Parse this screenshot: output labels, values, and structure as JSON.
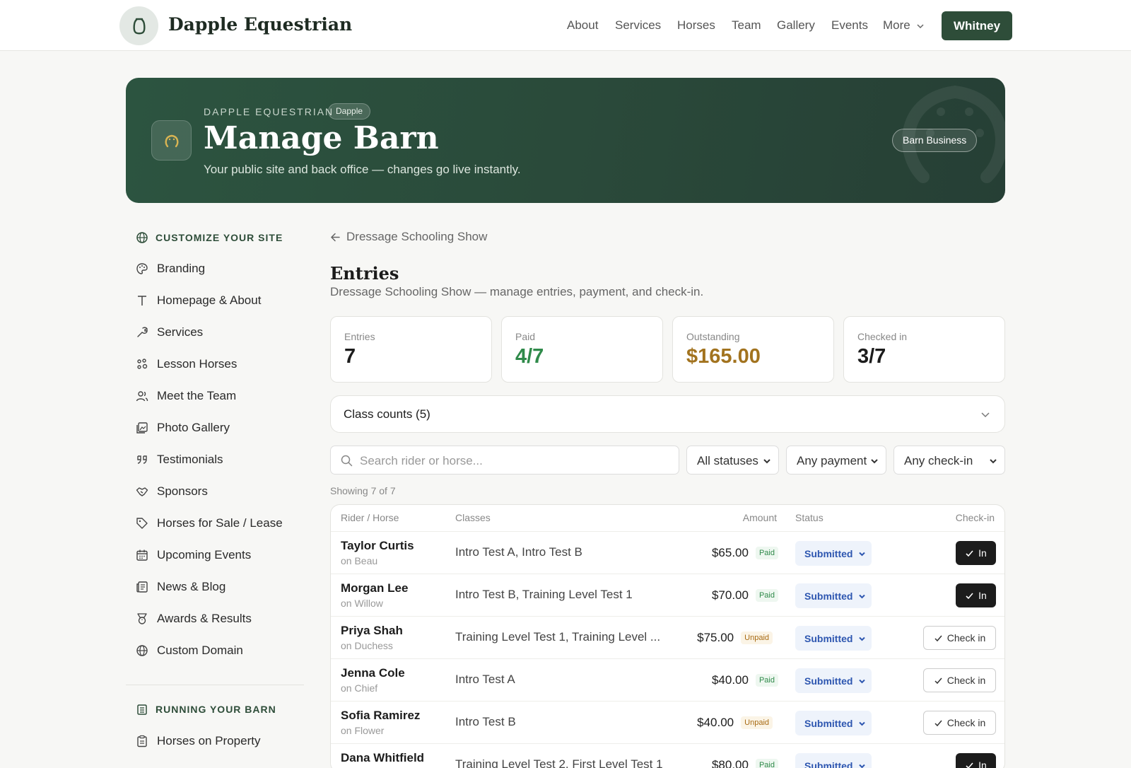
{
  "nav": {
    "brand": "Dapple Equestrian",
    "links": [
      "About",
      "Services",
      "Horses",
      "Team",
      "Gallery",
      "Events",
      "More"
    ],
    "user": "Whitney"
  },
  "hero": {
    "eyebrow": "DAPPLE EQUESTRIAN",
    "chip": "Dapple",
    "title": "Manage Barn",
    "subtitle": "Your public site and back office — changes go live instantly.",
    "badge": "Barn Business"
  },
  "sidebar": {
    "customize_heading": "CUSTOMIZE YOUR SITE",
    "customize_items": [
      {
        "label": "Branding",
        "icon": "palette-icon"
      },
      {
        "label": "Homepage & About",
        "icon": "text-icon"
      },
      {
        "label": "Services",
        "icon": "wrench-icon"
      },
      {
        "label": "Lesson Horses",
        "icon": "horse-icon"
      },
      {
        "label": "Meet the Team",
        "icon": "users-icon"
      },
      {
        "label": "Photo Gallery",
        "icon": "gallery-icon"
      },
      {
        "label": "Testimonials",
        "icon": "quote-icon"
      },
      {
        "label": "Sponsors",
        "icon": "handshake-icon"
      },
      {
        "label": "Horses for Sale / Lease",
        "icon": "tag-icon"
      },
      {
        "label": "Upcoming Events",
        "icon": "calendar-icon"
      },
      {
        "label": "News & Blog",
        "icon": "newspaper-icon"
      },
      {
        "label": "Awards & Results",
        "icon": "award-icon"
      },
      {
        "label": "Custom Domain",
        "icon": "globe-icon"
      }
    ],
    "running_heading": "RUNNING YOUR BARN",
    "running_items": [
      {
        "label": "Horses on Property",
        "icon": "clipboard-icon"
      }
    ]
  },
  "main": {
    "back_label": "Dressage Schooling Show",
    "title": "Entries",
    "subtitle": "Dressage Schooling Show — manage entries, payment, and check-in.",
    "stats": [
      {
        "label": "Entries",
        "value": "7",
        "color": "#1c1c1c"
      },
      {
        "label": "Paid",
        "value": "4/7",
        "color": "#2f8a4a"
      },
      {
        "label": "Outstanding",
        "value": "$165.00",
        "color": "#a2731f"
      },
      {
        "label": "Checked in",
        "value": "3/7",
        "color": "#1c1c1c"
      }
    ],
    "class_counts_label": "Class counts (5)",
    "search_placeholder": "Search rider or horse...",
    "filters": [
      "All statuses",
      "Any payment",
      "Any check-in"
    ],
    "showing": "Showing 7 of 7",
    "columns": [
      "Rider / Horse",
      "Classes",
      "Amount",
      "Status",
      "Check-in"
    ],
    "rows": [
      {
        "rider": "Taylor Curtis",
        "horse": "on Beau",
        "classes": "Intro Test A, Intro Test B",
        "amount": "$65.00",
        "payment": "Paid",
        "status": "Submitted",
        "checkin": "In"
      },
      {
        "rider": "Morgan Lee",
        "horse": "on Willow",
        "classes": "Intro Test B, Training Level Test 1",
        "amount": "$70.00",
        "payment": "Paid",
        "status": "Submitted",
        "checkin": "In"
      },
      {
        "rider": "Priya Shah",
        "horse": "on Duchess",
        "classes": "Training Level Test 1, Training Level ...",
        "amount": "$75.00",
        "payment": "Unpaid",
        "status": "Submitted",
        "checkin": "Check in"
      },
      {
        "rider": "Jenna Cole",
        "horse": "on Chief",
        "classes": "Intro Test A",
        "amount": "$40.00",
        "payment": "Paid",
        "status": "Submitted",
        "checkin": "Check in"
      },
      {
        "rider": "Sofia Ramirez",
        "horse": "on Flower",
        "classes": "Intro Test B",
        "amount": "$40.00",
        "payment": "Unpaid",
        "status": "Submitted",
        "checkin": "Check in"
      },
      {
        "rider": "Dana Whitfield",
        "horse": "",
        "classes": "Training Level Test 2, First Level Test 1",
        "amount": "$80.00",
        "payment": "Paid",
        "status": "Submitted",
        "checkin": "In"
      }
    ]
  }
}
